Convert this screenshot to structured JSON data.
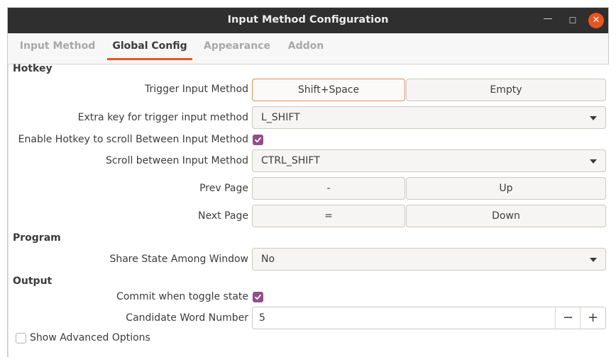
{
  "window": {
    "title": "Input Method Configuration",
    "minimize_glyph": "—",
    "maximize_glyph": "☐",
    "close_glyph": "✕"
  },
  "tabs": [
    {
      "label": "Input Method",
      "active": false
    },
    {
      "label": "Global Config",
      "active": true
    },
    {
      "label": "Appearance",
      "active": false
    },
    {
      "label": "Addon",
      "active": false
    }
  ],
  "hotkey": {
    "section_label": "Hotkey",
    "trigger": {
      "label": "Trigger Input Method",
      "key1": "Shift+Space",
      "key2": "Empty"
    },
    "extra_key": {
      "label": "Extra key for trigger input method",
      "value": "L_SHIFT"
    },
    "enable_scroll": {
      "label": "Enable Hotkey to scroll Between Input Method",
      "checked": true
    },
    "scroll_between": {
      "label": "Scroll between Input Method",
      "value": "CTRL_SHIFT"
    },
    "prev_page": {
      "label": "Prev Page",
      "key1": "-",
      "key2": "Up"
    },
    "next_page": {
      "label": "Next Page",
      "key1": "=",
      "key2": "Down"
    }
  },
  "program": {
    "section_label": "Program",
    "share_state": {
      "label": "Share State Among Window",
      "value": "No"
    }
  },
  "output": {
    "section_label": "Output",
    "commit_toggle": {
      "label": "Commit when toggle state",
      "checked": true
    },
    "candidate_number": {
      "label": "Candidate Word Number",
      "value": "5",
      "minus": "−",
      "plus": "+"
    }
  },
  "advanced": {
    "label": "Show Advanced Options",
    "checked": false
  },
  "colors": {
    "accent": "#e95420",
    "checkbox": "#924d8b",
    "titlebar": "#2f2f2f"
  }
}
